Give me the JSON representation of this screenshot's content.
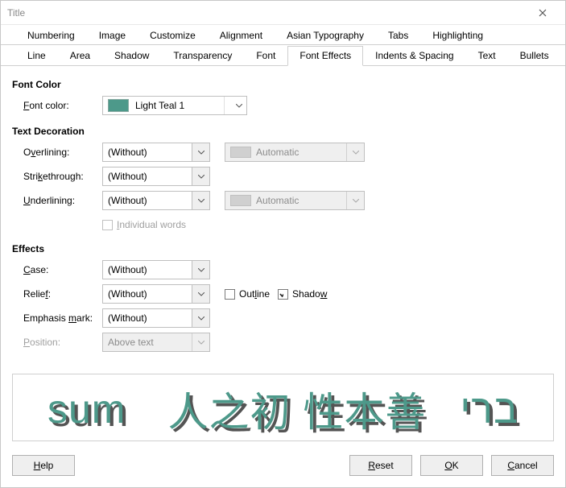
{
  "window": {
    "title": "Title"
  },
  "tabs": {
    "row1": [
      "Numbering",
      "Image",
      "Customize",
      "Alignment",
      "Asian Typography",
      "Tabs",
      "Highlighting"
    ],
    "row2": [
      "Line",
      "Area",
      "Shadow",
      "Transparency",
      "Font",
      "Font Effects",
      "Indents & Spacing",
      "Text",
      "Bullets"
    ],
    "active": "Font Effects"
  },
  "sections": {
    "fontColor": {
      "header": "Font Color",
      "label_html": "<span class='ul'>F</span>ont color:",
      "value": "Light Teal 1",
      "swatch": "#4d998a"
    },
    "decoration": {
      "header": "Text Decoration",
      "overlining_label_html": "O<span class='ul'>v</span>erlining:",
      "overlining_value": "(Without)",
      "overlining_color": "Automatic",
      "strike_label_html": "Stri<span class='ul'>k</span>ethrough:",
      "strike_value": "(Without)",
      "underlining_label_html": "<span class='ul'>U</span>nderlining:",
      "underlining_value": "(Without)",
      "underlining_color": "Automatic",
      "individual_label_html": "<span class='ul'>I</span>ndividual words",
      "individual_checked": false,
      "individual_enabled": false
    },
    "effects": {
      "header": "Effects",
      "case_label_html": "<span class='ul'>C</span>ase:",
      "case_value": "(Without)",
      "relief_label_html": "Relie<span class='ul'>f</span>:",
      "relief_value": "(Without)",
      "outline_label_html": "Out<span class='ul'>l</span>ine",
      "outline_checked": false,
      "shadow_label_html": "Shado<span class='ul'>w</span>",
      "shadow_checked": true,
      "emphasis_label_html": "Emphasis <span class='ul'>m</span>ark:",
      "emphasis_value": "(Without)",
      "position_label_html": "<span class='ul'>P</span>osition:",
      "position_value": "Above text",
      "position_enabled": false
    }
  },
  "preview": {
    "segments": [
      "sum",
      "人之初 性本善",
      "ברי"
    ],
    "color": "#4d998a",
    "shadow": true
  },
  "buttons": {
    "help_html": "<span class='ul'>H</span>elp",
    "reset_html": "<span class='ul'>R</span>eset",
    "ok_html": "<span class='ul'>O</span>K",
    "cancel_html": "<span class='ul'>C</span>ancel"
  }
}
